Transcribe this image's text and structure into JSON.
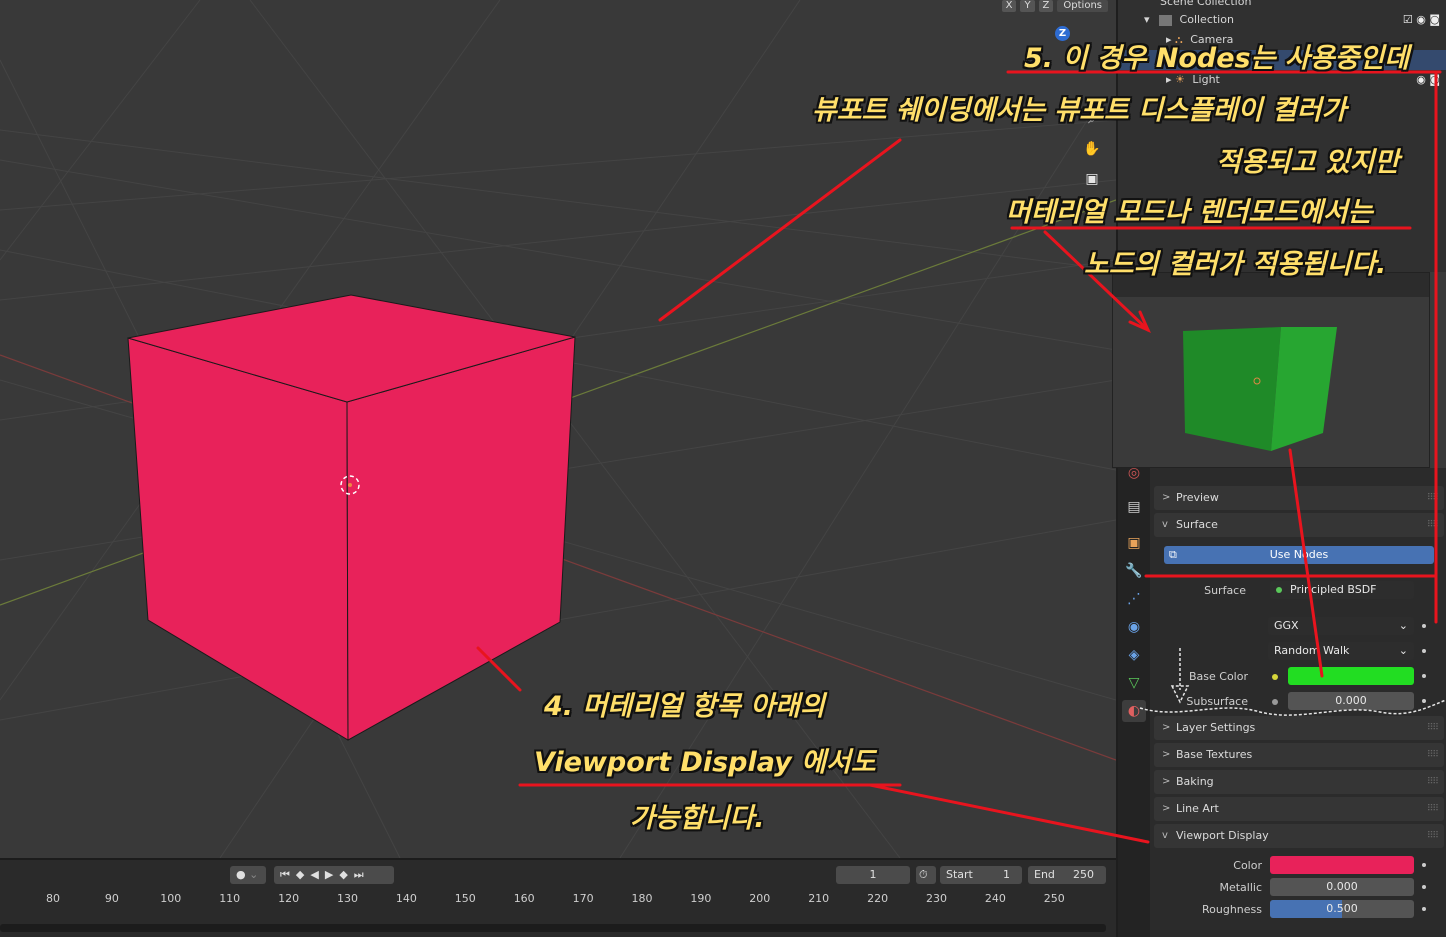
{
  "viewport": {
    "axis_buttons": [
      "X",
      "Y",
      "Z"
    ],
    "options_label": "Options",
    "gizmo_z": "Z",
    "cube_color": "#e8225a",
    "grid_color": "#404040"
  },
  "outliner": {
    "scene_collection": "Scene Collection",
    "collection": "Collection",
    "items": [
      "Camera",
      "Light"
    ]
  },
  "properties": {
    "preview_panel": "Preview",
    "surface_panel": "Surface",
    "use_nodes_label": "Use Nodes",
    "surface_label": "Surface",
    "surface_value": "Principled BSDF",
    "dist_value": "GGX",
    "subsurface_method": "Random Walk",
    "base_color_label": "Base Color",
    "base_color": "#22dd22",
    "subsurface_label": "Subsurface",
    "subsurface_value": "0.000",
    "layer_settings": "Layer Settings",
    "base_textures": "Base Textures",
    "baking": "Baking",
    "line_art": "Line Art",
    "viewport_display": "Viewport Display",
    "color_label": "Color",
    "vd_color": "#e8225a",
    "metallic_label": "Metallic",
    "metallic_value": "0.000",
    "roughness_label": "Roughness",
    "roughness_value": "0.500",
    "roughness_fraction": 0.5
  },
  "timeline": {
    "current_frame": "1",
    "start_label": "Start",
    "start_value": "1",
    "end_label": "End",
    "end_value": "250",
    "ticks": [
      "80",
      "90",
      "100",
      "110",
      "120",
      "130",
      "140",
      "150",
      "160",
      "170",
      "180",
      "190",
      "200",
      "210",
      "220",
      "230",
      "240",
      "250"
    ]
  },
  "annotations": {
    "note5_line1": "5. 이 경우  Nodes는 사용중인데",
    "note5_line2": "뷰포트 쉐이딩에서는 뷰포트 디스플레이 컬러가",
    "note5_line3": "적용되고 있지만",
    "note5_line4": "머테리얼 모드나 렌더모드에서는",
    "note5_line5": "노드의 컬러가 적용됩니다.",
    "note4_line1": "4. 머테리얼 항목 아래의",
    "note4_line2": "Viewport Display 에서도",
    "note4_line3": "가능합니다.",
    "annotation_color": "#ffdf6a",
    "arrow_color": "#e8141e"
  }
}
